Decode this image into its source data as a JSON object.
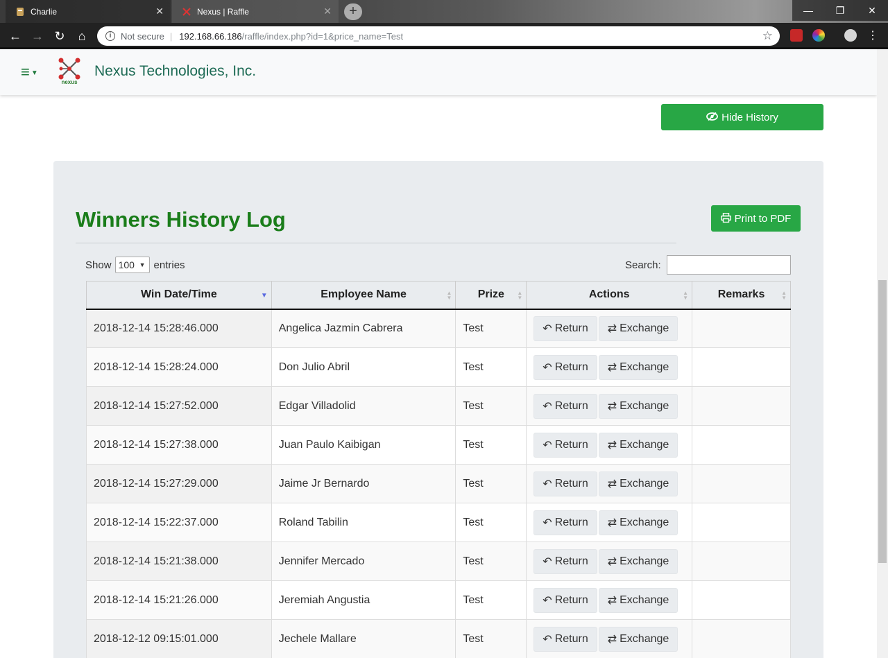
{
  "browser": {
    "tabs": [
      {
        "title": "Charlie",
        "active": false
      },
      {
        "title": "Nexus | Raffle",
        "active": true
      }
    ],
    "security_label": "Not secure",
    "url_host": "192.168.66.186",
    "url_path": "/raffle/index.php?id=1&price_name=Test"
  },
  "navbar": {
    "brand": "Nexus Technologies, Inc.",
    "logo_text": "nexus"
  },
  "actions": {
    "hide_history": "Hide History",
    "print_pdf": "Print to PDF"
  },
  "log": {
    "title": "Winners History Log",
    "show_label": "Show",
    "entries_value": "100",
    "entries_label": "entries",
    "search_label": "Search:",
    "columns": [
      "Win Date/Time",
      "Employee Name",
      "Prize",
      "Actions",
      "Remarks"
    ],
    "return_label": "Return",
    "exchange_label": "Exchange",
    "rows": [
      {
        "datetime": "2018-12-14 15:28:46.000",
        "name": "Angelica Jazmin Cabrera",
        "prize": "Test",
        "remarks": ""
      },
      {
        "datetime": "2018-12-14 15:28:24.000",
        "name": "Don Julio Abril",
        "prize": "Test",
        "remarks": ""
      },
      {
        "datetime": "2018-12-14 15:27:52.000",
        "name": "Edgar Villadolid",
        "prize": "Test",
        "remarks": ""
      },
      {
        "datetime": "2018-12-14 15:27:38.000",
        "name": "Juan Paulo Kaibigan",
        "prize": "Test",
        "remarks": ""
      },
      {
        "datetime": "2018-12-14 15:27:29.000",
        "name": "Jaime Jr Bernardo",
        "prize": "Test",
        "remarks": ""
      },
      {
        "datetime": "2018-12-14 15:22:37.000",
        "name": "Roland Tabilin",
        "prize": "Test",
        "remarks": ""
      },
      {
        "datetime": "2018-12-14 15:21:38.000",
        "name": "Jennifer Mercado",
        "prize": "Test",
        "remarks": ""
      },
      {
        "datetime": "2018-12-14 15:21:26.000",
        "name": "Jeremiah Angustia",
        "prize": "Test",
        "remarks": ""
      },
      {
        "datetime": "2018-12-12 09:15:01.000",
        "name": "Jechele Mallare",
        "prize": "Test",
        "remarks": ""
      }
    ]
  },
  "colors": {
    "accent_green": "#28a745",
    "title_green": "#1a7d1a",
    "brand_teal": "#1e6b55"
  }
}
